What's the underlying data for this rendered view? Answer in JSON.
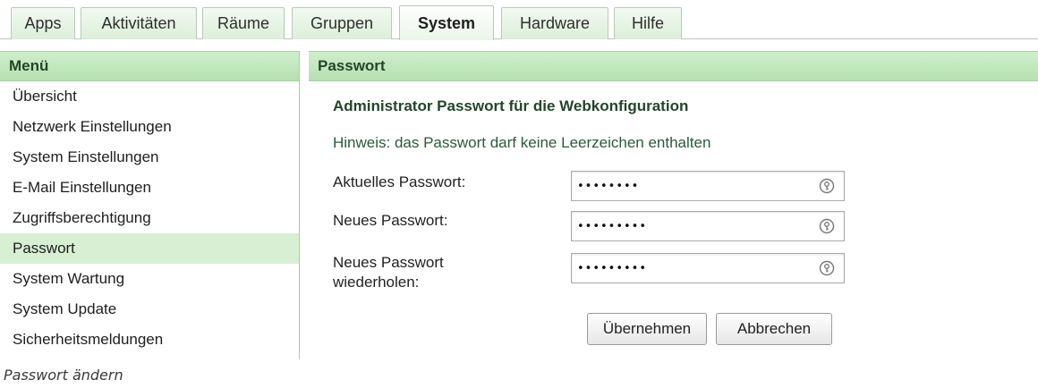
{
  "tabs": [
    {
      "label": "Apps"
    },
    {
      "label": "Aktivitäten"
    },
    {
      "label": "Räume"
    },
    {
      "label": "Gruppen"
    },
    {
      "label": "System",
      "active": true
    },
    {
      "label": "Hardware"
    },
    {
      "label": "Hilfe"
    }
  ],
  "menu": {
    "title": "Menü",
    "items": [
      {
        "label": "Übersicht"
      },
      {
        "label": "Netzwerk Einstellungen"
      },
      {
        "label": "System Einstellungen"
      },
      {
        "label": "E-Mail Einstellungen"
      },
      {
        "label": "Zugriffsberechtigung"
      },
      {
        "label": "Passwort",
        "active": true
      },
      {
        "label": "System Wartung"
      },
      {
        "label": "System Update"
      },
      {
        "label": "Sicherheitsmeldungen"
      }
    ]
  },
  "content": {
    "title": "Passwort",
    "section_title": "Administrator Passwort für die Webkonfiguration",
    "hint": "Hinweis: das Passwort darf keine Leerzeichen enthalten",
    "fields": [
      {
        "label": "Aktuelles Passwort:",
        "masked_value": "••••••••"
      },
      {
        "label": "Neues Passwort:",
        "masked_value": "•••••••••"
      },
      {
        "label": "Neues Passwort wiederholen:",
        "masked_value": "•••••••••"
      }
    ],
    "field_icon": "key-icon",
    "buttons": {
      "apply_label": "Übernehmen",
      "cancel_label": "Abbrechen"
    }
  },
  "caption": "Passwort ändern",
  "colors": {
    "header_green": "#b6e0b1",
    "tab_green": "#dcefd9",
    "active_menu_bg": "#d8efd4",
    "heading_text": "#24452a"
  }
}
